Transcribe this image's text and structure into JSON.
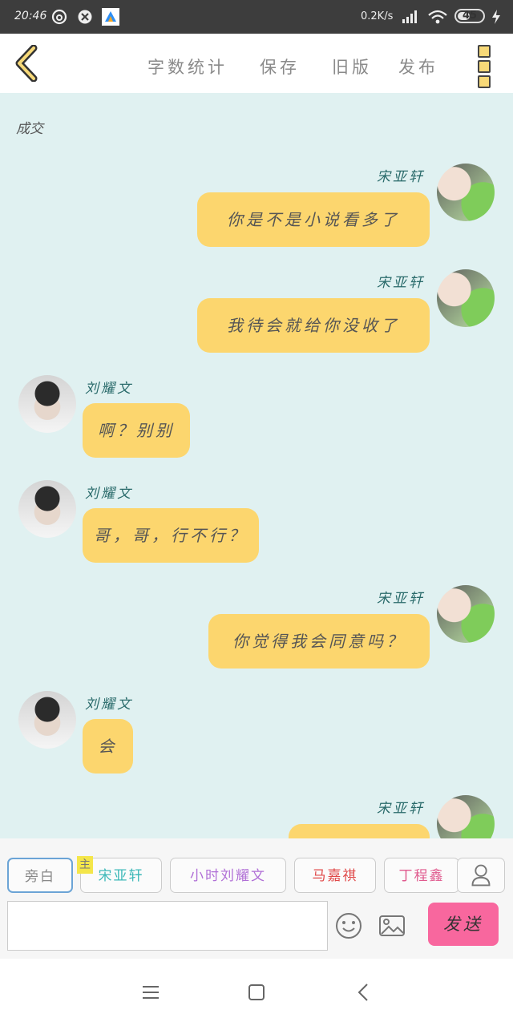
{
  "status_bar": {
    "time": "20:46",
    "net_speed": "0.2K/s",
    "battery": "45"
  },
  "toolbar": {
    "word_count": "字数统计",
    "save": "保存",
    "old_version": "旧版",
    "publish": "发布"
  },
  "chat": {
    "narration": "成交",
    "messages": [
      {
        "sender": "宋亚轩",
        "text": "你是不是小说看多了"
      },
      {
        "sender": "宋亚轩",
        "text": "我待会就给你没收了"
      },
      {
        "sender": "刘耀文",
        "text": "啊？别别"
      },
      {
        "sender": "刘耀文",
        "text": "哥，哥，行不行？"
      },
      {
        "sender": "宋亚轩",
        "text": "你觉得我会同意吗？"
      },
      {
        "sender": "刘耀文",
        "text": "会"
      },
      {
        "sender": "宋亚轩",
        "text": ""
      }
    ]
  },
  "roles": {
    "narration": "旁白",
    "main_tag": "主",
    "r1": "宋亚轩",
    "r2": "小时刘耀文",
    "r3": "马嘉祺",
    "r4": "丁程鑫"
  },
  "composer": {
    "input_value": "",
    "send": "发送"
  },
  "colors": {
    "chat_bg": "#e0f1f1",
    "bubble": "#fcd66e",
    "send_button": "#f8679e",
    "name_text": "#2a6b6b"
  },
  "icons": {
    "back": "chevron-left-icon",
    "more": "more-vertical-icon",
    "emoji": "smile-icon",
    "image": "image-icon",
    "person": "person-icon"
  }
}
